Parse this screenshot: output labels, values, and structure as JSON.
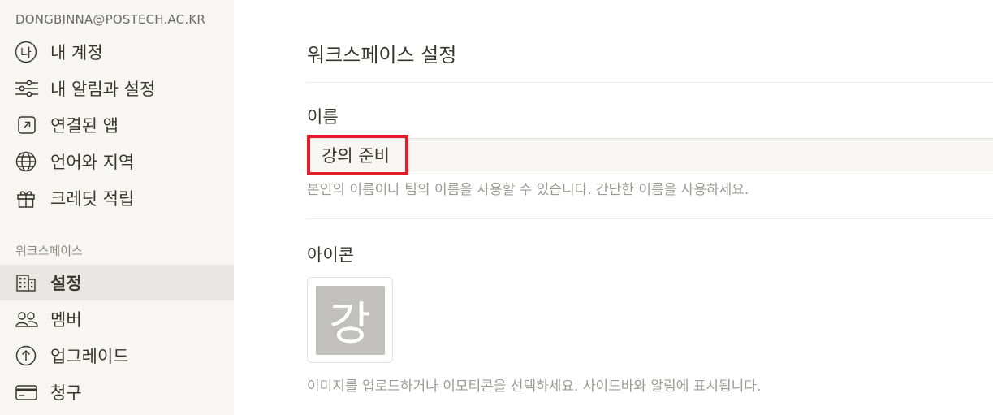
{
  "sidebar": {
    "account_email": "DONGBINNA@POSTECH.AC.KR",
    "account_items": [
      {
        "label": "내 계정",
        "icon": "avatar-icon"
      },
      {
        "label": "내 알림과 설정",
        "icon": "sliders-icon"
      },
      {
        "label": "연결된 앱",
        "icon": "external-link-icon"
      },
      {
        "label": "언어와 지역",
        "icon": "globe-icon"
      },
      {
        "label": "크레딧 적립",
        "icon": "gift-icon"
      }
    ],
    "avatar_char": "나",
    "workspace_section_label": "워크스페이스",
    "workspace_items": [
      {
        "label": "설정",
        "icon": "building-icon",
        "active": true
      },
      {
        "label": "멤버",
        "icon": "members-icon"
      },
      {
        "label": "업그레이드",
        "icon": "upgrade-arrow-icon"
      },
      {
        "label": "청구",
        "icon": "credit-card-icon"
      }
    ]
  },
  "main": {
    "title": "워크스페이스 설정",
    "name_label": "이름",
    "name_value": "강의 준비",
    "name_help": "본인의 이름이나 팀의 이름을 사용할 수 있습니다. 간단한 이름을 사용하세요.",
    "icon_label": "아이콘",
    "icon_char": "강",
    "icon_help": "이미지를 업로드하거나 이모티콘을 선택하세요. 사이드바와 알림에 표시됩니다."
  },
  "colors": {
    "sidebar_bg": "#f7f6f3",
    "active_item_bg": "#e9e7e3",
    "highlight_border": "#e41d2a",
    "icon_tile_bg": "#c1c0bd"
  }
}
